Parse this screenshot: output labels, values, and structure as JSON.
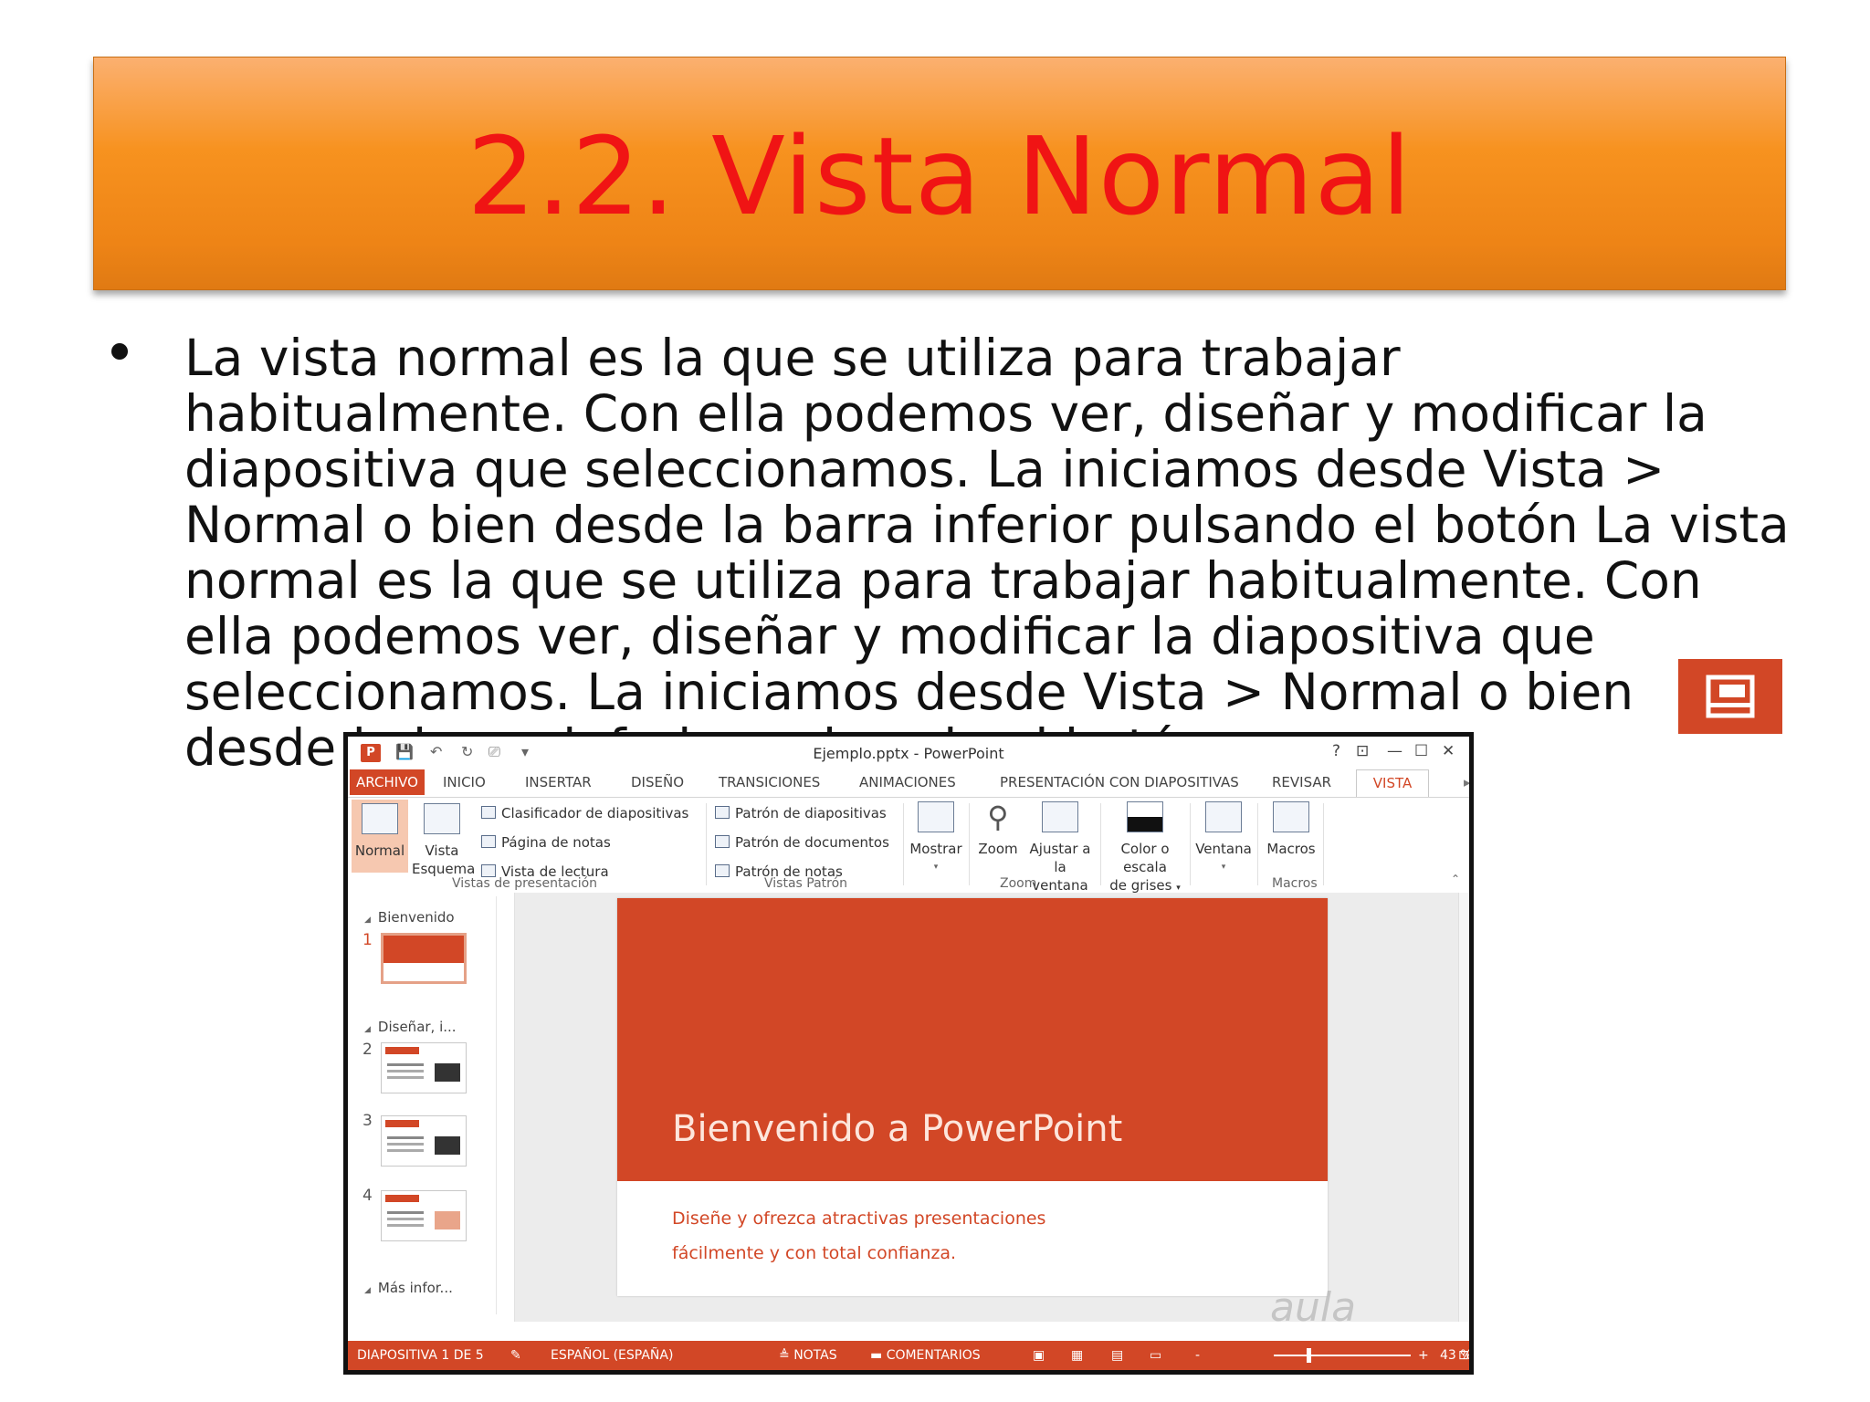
{
  "slide": {
    "title": "2.2. Vista Normal",
    "body": "La vista normal es la que se utiliza para trabajar habitualmente. Con ella podemos ver, diseñar y modificar la diapositiva que seleccionamos. La iniciamos desde Vista > Normal o bien desde la barra inferior pulsando el botón La vista normal es la que se utiliza para trabajar habitualmente. Con ella podemos ver, diseñar y modificar la diapositiva que seleccionamos. La iniciamos desde Vista > Normal o bien desde la barra inferior pulsando el botón",
    "accent_color": "#d24726",
    "title_color": "#f01414",
    "banner_color": "#f7921f"
  },
  "ppt": {
    "window_title": "Ejemplo.pptx - PowerPoint",
    "window_buttons": {
      "help": "?",
      "ribbon_opts": "⊡",
      "minimize": "—",
      "maximize": "☐",
      "close": "✕"
    },
    "tabs": [
      "ARCHIVO",
      "INICIO",
      "INSERTAR",
      "DISEÑO",
      "TRANSICIONES",
      "ANIMACIONES",
      "PRESENTACIÓN CON DIAPOSITIVAS",
      "REVISAR",
      "VISTA"
    ],
    "ribbon": {
      "normal": "Normal",
      "vista_esquema_1": "Vista",
      "vista_esquema_2": "Esquema",
      "clasificador": "Clasificador de diapositivas",
      "pagina_notas": "Página de notas",
      "vista_lectura": "Vista de lectura",
      "group_vistas": "Vistas de presentación",
      "patron_diapositivas": "Patrón de diapositivas",
      "patron_documentos": "Patrón de documentos",
      "patron_notas": "Patrón de notas",
      "group_patron": "Vistas Patrón",
      "mostrar": "Mostrar",
      "zoom": "Zoom",
      "ajustar_1": "Ajustar a",
      "ajustar_2": "la ventana",
      "group_zoom": "Zoom",
      "color_1": "Color o escala",
      "color_2": "de grises",
      "ventana": "Ventana",
      "macros": "Macros",
      "group_macros": "Macros"
    },
    "sections": [
      "Bienvenido",
      "Diseñar, i...",
      "Más infor..."
    ],
    "thumb_numbers": [
      "1",
      "2",
      "3",
      "4"
    ],
    "slide_title": "Bienvenido a PowerPoint",
    "slide_sub_1": "Diseñe y ofrezca atractivas presentaciones",
    "slide_sub_2": "fácilmente y con total confianza.",
    "watermark": "aula",
    "status": {
      "slide_count": "DIAPOSITIVA 1 DE 5",
      "language": "ESPAÑOL (ESPAÑA)",
      "notes": "NOTAS",
      "comments": "COMENTARIOS",
      "zoom_minus": "-",
      "zoom_plus": "+",
      "zoom": "43 %",
      "zoom_level": 0.24
    }
  }
}
